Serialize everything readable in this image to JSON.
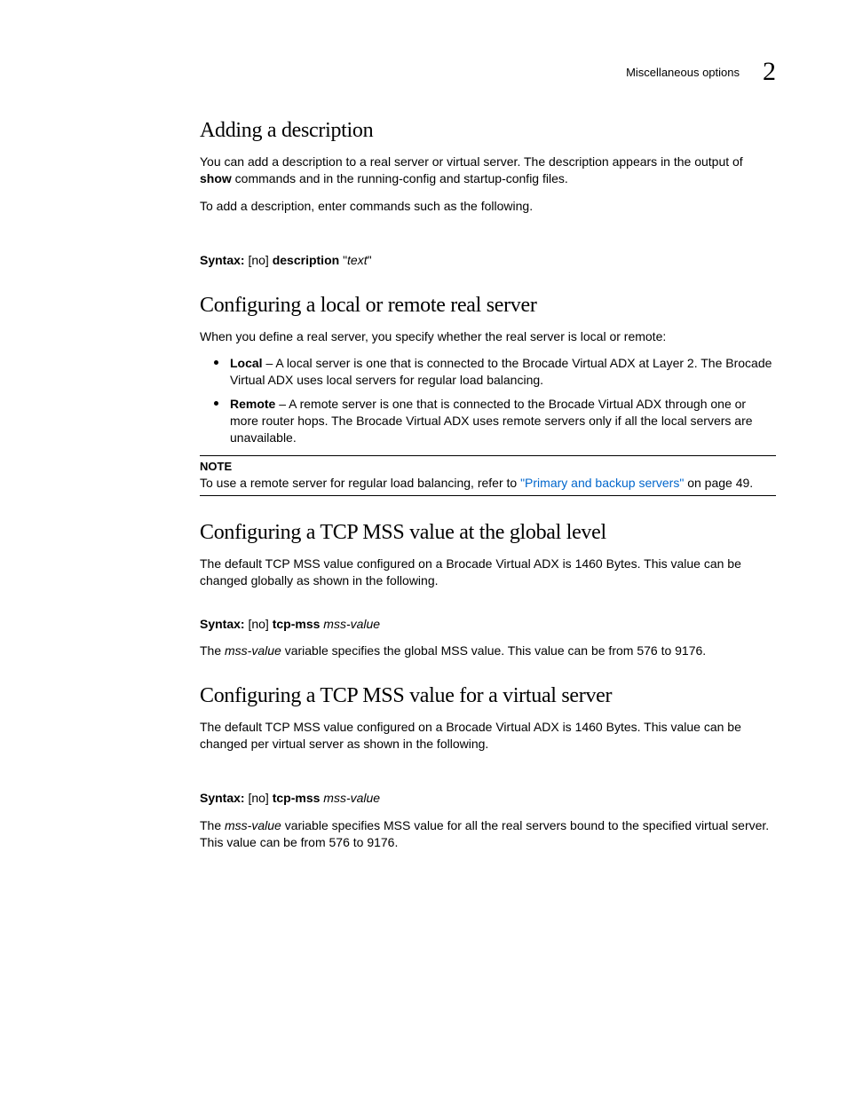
{
  "header": {
    "running_title": "Miscellaneous options",
    "chapter_number": "2"
  },
  "sections": {
    "adding_description": {
      "title": "Adding a description",
      "p1_a": "You can add a description to a real server or virtual server. The description appears in the output of ",
      "p1_bold": "show",
      "p1_b": " commands and in the running-config and startup-config files.",
      "p2": "To add a description, enter commands such as the following.",
      "syntax_label": "Syntax: ",
      "syntax_no": "[no] ",
      "syntax_cmd": "description",
      "syntax_q1": " \"",
      "syntax_arg": "text",
      "syntax_q2": "\""
    },
    "local_remote": {
      "title": "Configuring a local or remote real server",
      "intro": "When you define a real server, you specify whether the real server is local or remote:",
      "bullets": [
        {
          "label": "Local",
          "rest": " – A local server is one that is connected to the Brocade Virtual ADX at Layer 2. The Brocade Virtual ADX uses local servers for regular load balancing."
        },
        {
          "label": "Remote",
          "rest": " – A remote server is one that is connected to the Brocade Virtual ADX through one or more router hops. The Brocade Virtual ADX uses remote servers only if all the local servers are unavailable."
        }
      ],
      "note_label": "NOTE",
      "note_before": "To use a remote server for regular load balancing, refer to ",
      "note_link": "\"Primary and backup servers\"",
      "note_after": " on page 49."
    },
    "mss_global": {
      "title": "Configuring a TCP MSS value at the global level",
      "p1": "The default TCP MSS value configured on a Brocade Virtual ADX is 1460 Bytes. This value can be changed globally as shown in the following.",
      "syntax_label": "Syntax: ",
      "syntax_no": "[no] ",
      "syntax_cmd": "tcp-mss ",
      "syntax_arg": "mss-value",
      "p2_a": "The ",
      "p2_i": "mss-value",
      "p2_b": " variable specifies the global MSS value. This value can be from 576 to 9176."
    },
    "mss_vs": {
      "title": "Configuring a TCP MSS value for a virtual server",
      "p1": "The default TCP MSS value configured on a Brocade Virtual ADX is 1460 Bytes. This value can be changed per virtual server as shown in the following.",
      "syntax_label": "Syntax: ",
      "syntax_no": "[no] ",
      "syntax_cmd": "tcp-mss ",
      "syntax_arg": "mss-value",
      "p2_a": "The ",
      "p2_i": "mss-value",
      "p2_b": " variable specifies MSS value for all the real servers bound to the specified virtual server. This value can be from 576 to 9176."
    }
  }
}
